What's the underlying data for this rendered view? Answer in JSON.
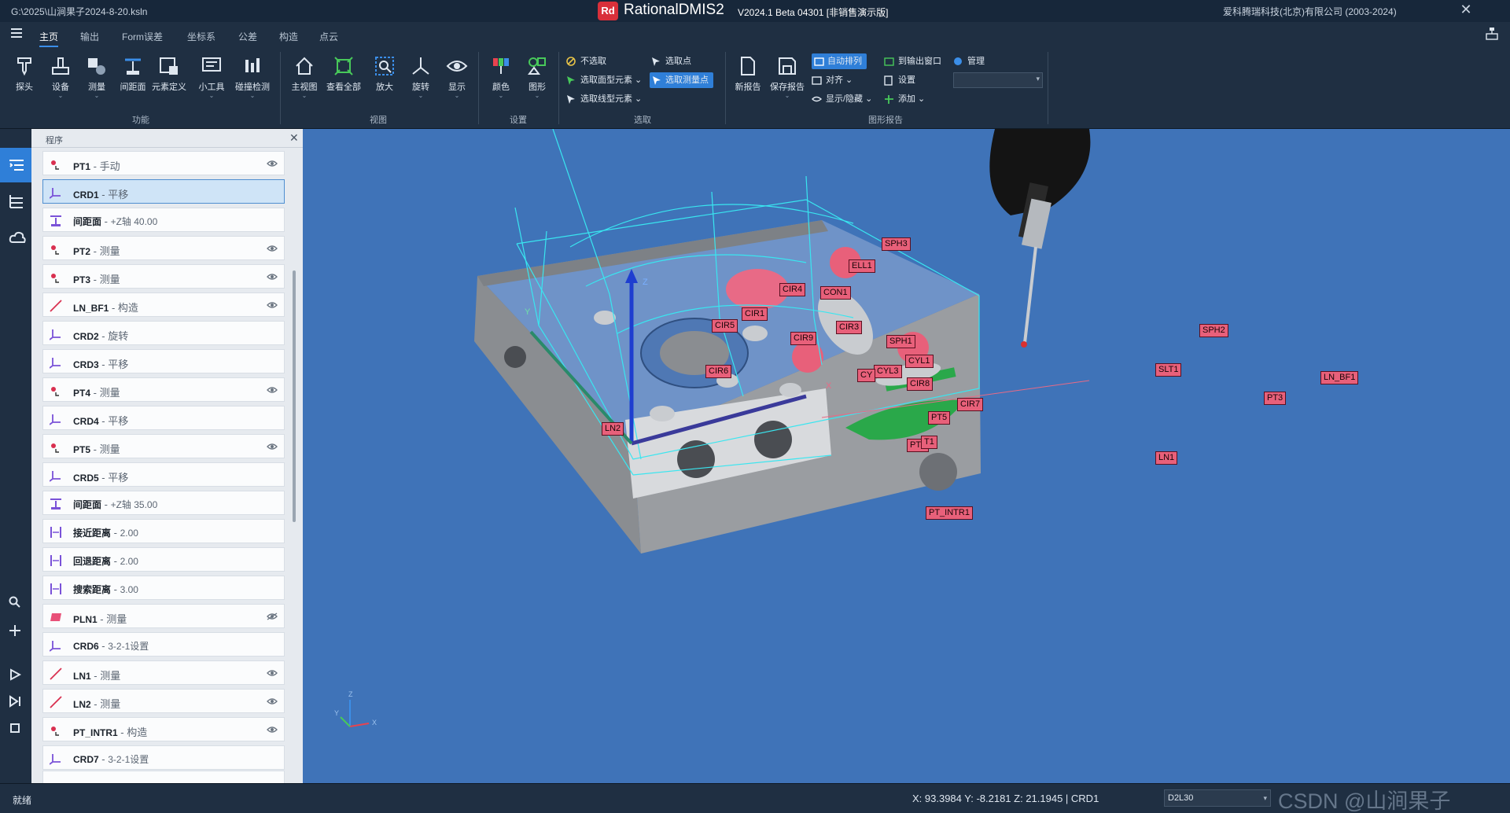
{
  "titlebar": {
    "file_path": "G:\\2025\\山涧果子2024-8-20.ksln",
    "logo_text": "Rd",
    "app_name": "RationalDMIS2",
    "version": "V2024.1 Beta 04301 [非销售演示版]",
    "company": "爱科腾瑞科技(北京)有限公司 (2003-2024)",
    "close_glyph": "✕"
  },
  "menu": {
    "tabs": [
      "主页",
      "输出",
      "Form误差",
      "坐标系",
      "公差",
      "构造",
      "点云"
    ],
    "active_tab": "主页"
  },
  "ribbon": {
    "groups": {
      "function": "功能",
      "view": "视图",
      "settings": "设置",
      "select": "选取",
      "report": "图形报告"
    },
    "buttons": {
      "probe": "探头",
      "device": "设备",
      "measure": "测量",
      "distance_plane": "间距面",
      "element_def": "元素定义",
      "small_tools": "小工具",
      "collision": "碰撞检测",
      "main_view": "主视图",
      "view_all": "查看全部",
      "zoom": "放大",
      "rotate": "旋转",
      "display": "显示",
      "color": "颜色",
      "graphic": "图形",
      "new_report": "新报告",
      "save_report": "保存报告"
    },
    "select_items": {
      "no_select": "不选取",
      "select_surface": "选取面型元素",
      "select_line": "选取线型元素",
      "select_point": "选取点",
      "select_measured_point": "选取测量点"
    },
    "report_items": {
      "auto_arrange": "自动排列",
      "to_output": "到输出窗口",
      "manage": "管理",
      "align": "对齐",
      "settings": "设置",
      "show_hide": "显示/隐藏",
      "add": "添加"
    }
  },
  "panel": {
    "title": "程序",
    "items": [
      {
        "name": "PT1",
        "desc": "手动",
        "icon": "point",
        "eye": "visible",
        "selected": false
      },
      {
        "name": "CRD1",
        "desc": "平移",
        "icon": "crd",
        "eye": "",
        "selected": true
      },
      {
        "name": "间距面",
        "desc": "+Z轴 40.00",
        "icon": "clearance",
        "eye": "",
        "selected": false
      },
      {
        "name": "PT2",
        "desc": "测量",
        "icon": "point",
        "eye": "visible",
        "selected": false
      },
      {
        "name": "PT3",
        "desc": "测量",
        "icon": "point",
        "eye": "visible",
        "selected": false
      },
      {
        "name": "LN_BF1",
        "desc": "构造",
        "icon": "line",
        "eye": "visible",
        "selected": false
      },
      {
        "name": "CRD2",
        "desc": "旋转",
        "icon": "crd",
        "eye": "",
        "selected": false
      },
      {
        "name": "CRD3",
        "desc": "平移",
        "icon": "crd",
        "eye": "",
        "selected": false
      },
      {
        "name": "PT4",
        "desc": "测量",
        "icon": "point",
        "eye": "visible",
        "selected": false
      },
      {
        "name": "CRD4",
        "desc": "平移",
        "icon": "crd",
        "eye": "",
        "selected": false
      },
      {
        "name": "PT5",
        "desc": "测量",
        "icon": "point",
        "eye": "visible",
        "selected": false
      },
      {
        "name": "CRD5",
        "desc": "平移",
        "icon": "crd",
        "eye": "",
        "selected": false
      },
      {
        "name": "间距面",
        "desc": "+Z轴 35.00",
        "icon": "clearance",
        "eye": "",
        "selected": false
      },
      {
        "name": "接近距离",
        "desc": "2.00",
        "icon": "dist",
        "eye": "",
        "selected": false
      },
      {
        "name": "回退距离",
        "desc": "2.00",
        "icon": "dist",
        "eye": "",
        "selected": false
      },
      {
        "name": "搜索距离",
        "desc": "3.00",
        "icon": "dist",
        "eye": "",
        "selected": false
      },
      {
        "name": "PLN1",
        "desc": "测量",
        "icon": "plane",
        "eye": "hidden",
        "selected": false
      },
      {
        "name": "CRD6",
        "desc": "3-2-1设置",
        "icon": "crd",
        "eye": "",
        "selected": false
      },
      {
        "name": "LN1",
        "desc": "测量",
        "icon": "line",
        "eye": "visible",
        "selected": false
      },
      {
        "name": "LN2",
        "desc": "测量",
        "icon": "line",
        "eye": "visible",
        "selected": false
      },
      {
        "name": "PT_INTR1",
        "desc": "构造",
        "icon": "point",
        "eye": "visible",
        "selected": false
      },
      {
        "name": "CRD7",
        "desc": "3-2-1设置",
        "icon": "crd",
        "eye": "",
        "selected": false
      }
    ]
  },
  "viewport": {
    "labels": [
      "LN2",
      "CIR5",
      "CIR1",
      "CIR4",
      "CON1",
      "ELL1",
      "SPH3",
      "CIR3",
      "CIR9",
      "SPH1",
      "CYL1",
      "CYL3",
      "CY",
      "CIR6",
      "CIR8",
      "SPH2",
      "SLT1",
      "LN_BF1",
      "PT3",
      "CIR7",
      "PT5",
      "PT4",
      "T1",
      "LN1",
      "PT_INTR1"
    ],
    "axis_labels": {
      "x": "X",
      "y": "Y",
      "z": "Z"
    }
  },
  "status": {
    "ready": "就绪",
    "coords": "X: 93.3984   Y: -8.2181   Z: 21.1945  |  CRD1",
    "probe_combo": "D2L30",
    "watermark": "CSDN @山涧果子"
  },
  "colors": {
    "accent": "#2f7fd8",
    "viewport_bg": "#3f73b8",
    "label_bg": "#e8607a",
    "wireframe": "#39e6f0",
    "part": "#8a8d91"
  }
}
